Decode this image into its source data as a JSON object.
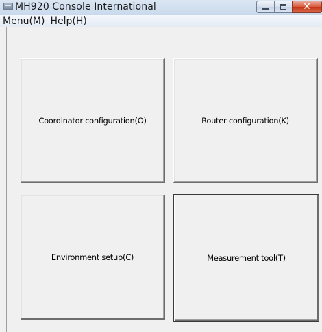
{
  "window": {
    "title": "MH920 Console International",
    "icon": "app-window-icon",
    "controls": {
      "minimize": "minimize-icon",
      "maximize": "maximize-icon",
      "close": "close-icon",
      "close_glyph": "✕"
    }
  },
  "menubar": {
    "items": [
      {
        "label": "Menu(M)"
      },
      {
        "label": "Help(H)"
      }
    ]
  },
  "tiles": {
    "coordinator": {
      "label": "Coordinator configuration(O)"
    },
    "router": {
      "label": "Router configuration(K)"
    },
    "environment": {
      "label": "Environment setup(C)"
    },
    "measurement": {
      "label": "Measurement tool(T)",
      "focused": true
    }
  },
  "colors": {
    "client_background": "#f0f0f0",
    "close_button": "#c43516",
    "titlebar": "#c9d9ec"
  }
}
